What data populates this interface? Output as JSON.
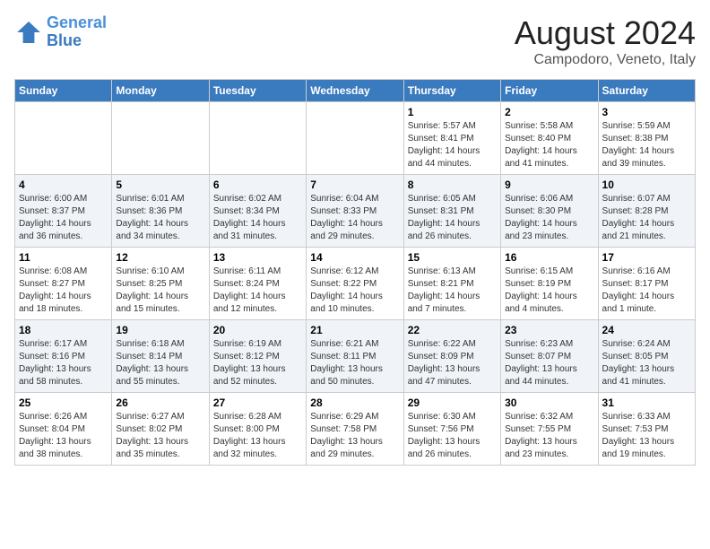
{
  "logo": {
    "line1": "General",
    "line2": "Blue"
  },
  "title": "August 2024",
  "subtitle": "Campodoro, Veneto, Italy",
  "weekdays": [
    "Sunday",
    "Monday",
    "Tuesday",
    "Wednesday",
    "Thursday",
    "Friday",
    "Saturday"
  ],
  "weeks": [
    [
      {
        "day": "",
        "info": ""
      },
      {
        "day": "",
        "info": ""
      },
      {
        "day": "",
        "info": ""
      },
      {
        "day": "",
        "info": ""
      },
      {
        "day": "1",
        "info": "Sunrise: 5:57 AM\nSunset: 8:41 PM\nDaylight: 14 hours\nand 44 minutes."
      },
      {
        "day": "2",
        "info": "Sunrise: 5:58 AM\nSunset: 8:40 PM\nDaylight: 14 hours\nand 41 minutes."
      },
      {
        "day": "3",
        "info": "Sunrise: 5:59 AM\nSunset: 8:38 PM\nDaylight: 14 hours\nand 39 minutes."
      }
    ],
    [
      {
        "day": "4",
        "info": "Sunrise: 6:00 AM\nSunset: 8:37 PM\nDaylight: 14 hours\nand 36 minutes."
      },
      {
        "day": "5",
        "info": "Sunrise: 6:01 AM\nSunset: 8:36 PM\nDaylight: 14 hours\nand 34 minutes."
      },
      {
        "day": "6",
        "info": "Sunrise: 6:02 AM\nSunset: 8:34 PM\nDaylight: 14 hours\nand 31 minutes."
      },
      {
        "day": "7",
        "info": "Sunrise: 6:04 AM\nSunset: 8:33 PM\nDaylight: 14 hours\nand 29 minutes."
      },
      {
        "day": "8",
        "info": "Sunrise: 6:05 AM\nSunset: 8:31 PM\nDaylight: 14 hours\nand 26 minutes."
      },
      {
        "day": "9",
        "info": "Sunrise: 6:06 AM\nSunset: 8:30 PM\nDaylight: 14 hours\nand 23 minutes."
      },
      {
        "day": "10",
        "info": "Sunrise: 6:07 AM\nSunset: 8:28 PM\nDaylight: 14 hours\nand 21 minutes."
      }
    ],
    [
      {
        "day": "11",
        "info": "Sunrise: 6:08 AM\nSunset: 8:27 PM\nDaylight: 14 hours\nand 18 minutes."
      },
      {
        "day": "12",
        "info": "Sunrise: 6:10 AM\nSunset: 8:25 PM\nDaylight: 14 hours\nand 15 minutes."
      },
      {
        "day": "13",
        "info": "Sunrise: 6:11 AM\nSunset: 8:24 PM\nDaylight: 14 hours\nand 12 minutes."
      },
      {
        "day": "14",
        "info": "Sunrise: 6:12 AM\nSunset: 8:22 PM\nDaylight: 14 hours\nand 10 minutes."
      },
      {
        "day": "15",
        "info": "Sunrise: 6:13 AM\nSunset: 8:21 PM\nDaylight: 14 hours\nand 7 minutes."
      },
      {
        "day": "16",
        "info": "Sunrise: 6:15 AM\nSunset: 8:19 PM\nDaylight: 14 hours\nand 4 minutes."
      },
      {
        "day": "17",
        "info": "Sunrise: 6:16 AM\nSunset: 8:17 PM\nDaylight: 14 hours\nand 1 minute."
      }
    ],
    [
      {
        "day": "18",
        "info": "Sunrise: 6:17 AM\nSunset: 8:16 PM\nDaylight: 13 hours\nand 58 minutes."
      },
      {
        "day": "19",
        "info": "Sunrise: 6:18 AM\nSunset: 8:14 PM\nDaylight: 13 hours\nand 55 minutes."
      },
      {
        "day": "20",
        "info": "Sunrise: 6:19 AM\nSunset: 8:12 PM\nDaylight: 13 hours\nand 52 minutes."
      },
      {
        "day": "21",
        "info": "Sunrise: 6:21 AM\nSunset: 8:11 PM\nDaylight: 13 hours\nand 50 minutes."
      },
      {
        "day": "22",
        "info": "Sunrise: 6:22 AM\nSunset: 8:09 PM\nDaylight: 13 hours\nand 47 minutes."
      },
      {
        "day": "23",
        "info": "Sunrise: 6:23 AM\nSunset: 8:07 PM\nDaylight: 13 hours\nand 44 minutes."
      },
      {
        "day": "24",
        "info": "Sunrise: 6:24 AM\nSunset: 8:05 PM\nDaylight: 13 hours\nand 41 minutes."
      }
    ],
    [
      {
        "day": "25",
        "info": "Sunrise: 6:26 AM\nSunset: 8:04 PM\nDaylight: 13 hours\nand 38 minutes."
      },
      {
        "day": "26",
        "info": "Sunrise: 6:27 AM\nSunset: 8:02 PM\nDaylight: 13 hours\nand 35 minutes."
      },
      {
        "day": "27",
        "info": "Sunrise: 6:28 AM\nSunset: 8:00 PM\nDaylight: 13 hours\nand 32 minutes."
      },
      {
        "day": "28",
        "info": "Sunrise: 6:29 AM\nSunset: 7:58 PM\nDaylight: 13 hours\nand 29 minutes."
      },
      {
        "day": "29",
        "info": "Sunrise: 6:30 AM\nSunset: 7:56 PM\nDaylight: 13 hours\nand 26 minutes."
      },
      {
        "day": "30",
        "info": "Sunrise: 6:32 AM\nSunset: 7:55 PM\nDaylight: 13 hours\nand 23 minutes."
      },
      {
        "day": "31",
        "info": "Sunrise: 6:33 AM\nSunset: 7:53 PM\nDaylight: 13 hours\nand 19 minutes."
      }
    ]
  ]
}
